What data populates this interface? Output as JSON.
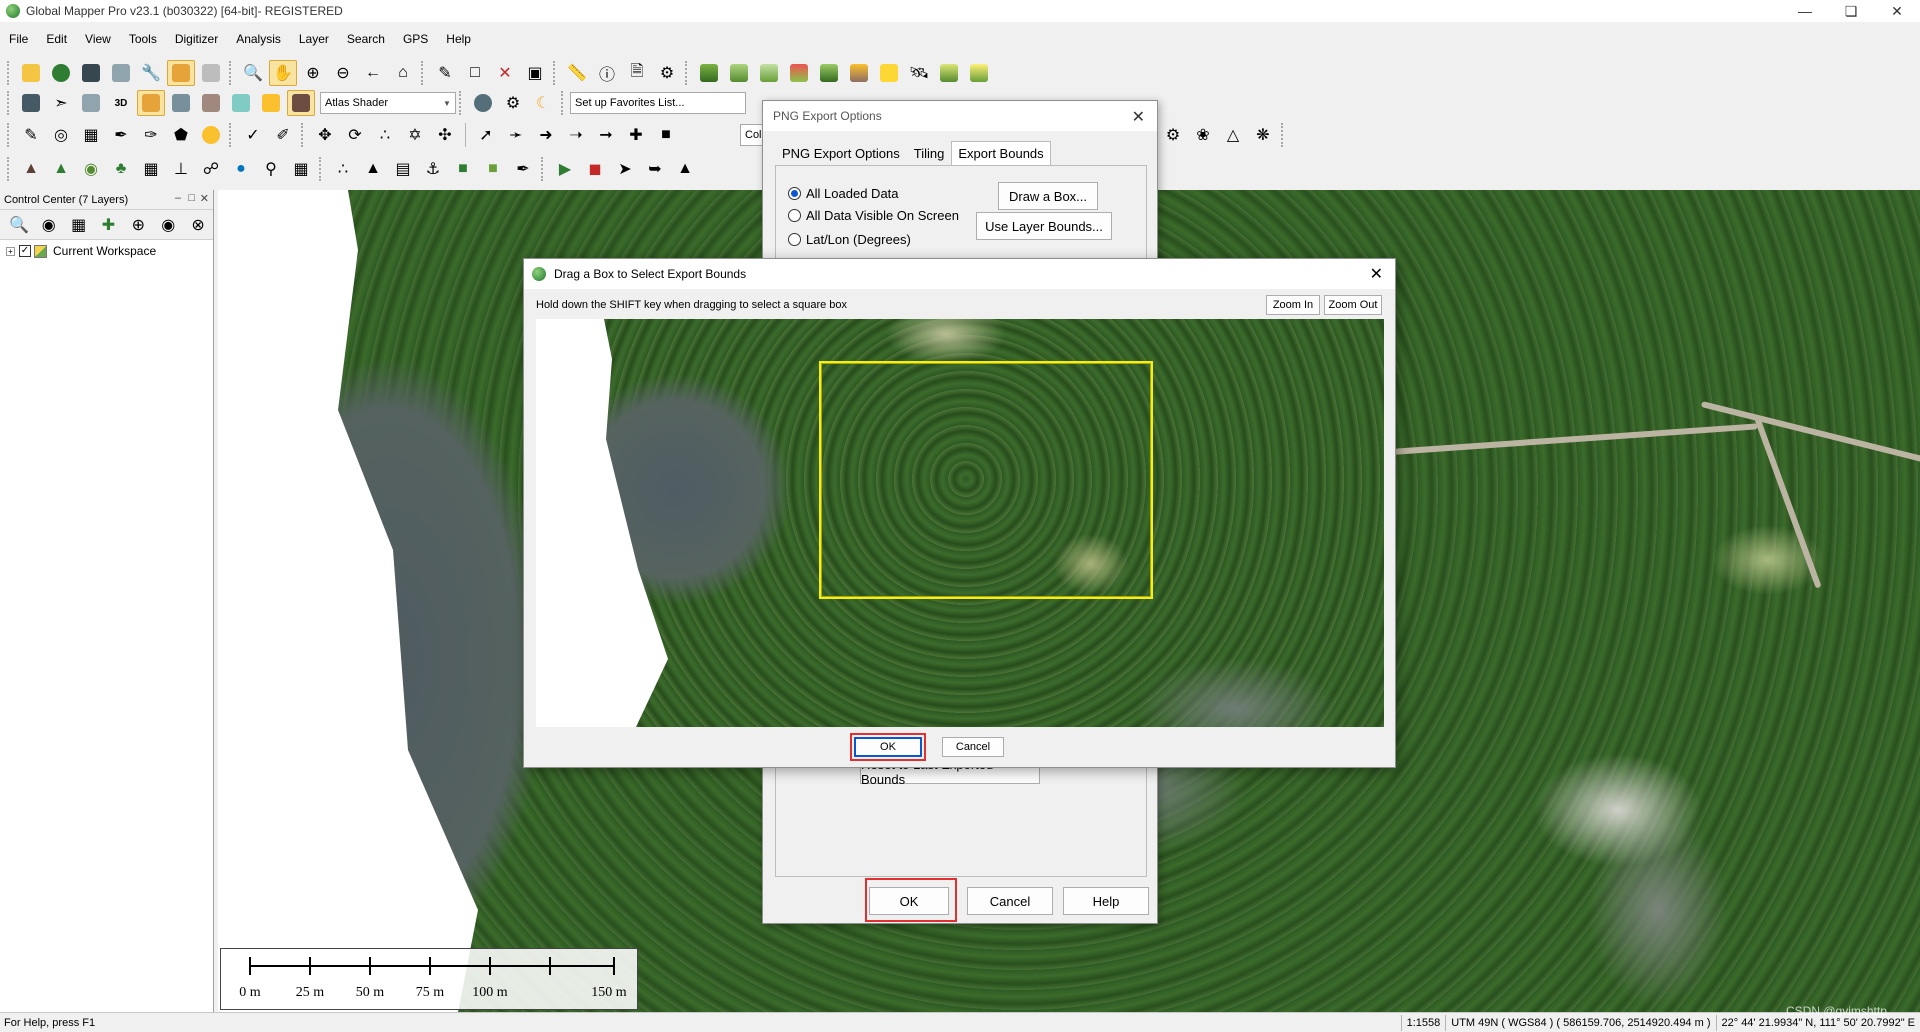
{
  "window": {
    "title": "Global Mapper Pro v23.1 (b030322) [64-bit]- REGISTERED"
  },
  "menu": [
    "File",
    "Edit",
    "View",
    "Tools",
    "Digitizer",
    "Analysis",
    "Layer",
    "Search",
    "GPS",
    "Help"
  ],
  "toolbar": {
    "shader_combo": "Atlas Shader",
    "favorites_combo": "Set up Favorites List...",
    "color_combo_partial": "Colo"
  },
  "control_center": {
    "title": "Control Center (7 Layers)",
    "workspace_label": "Current Workspace"
  },
  "scale_bar": {
    "labels": [
      "0 m",
      "25 m",
      "50 m",
      "75 m",
      "100 m",
      "150 m"
    ]
  },
  "status": {
    "help": "For Help, press F1",
    "scale": "1:1558",
    "projection": "UTM 49N ( WGS84 ) ( 586159.706, 2514920.494 m )",
    "latlon": "22° 44' 21.9934\" N, 111° 50' 20.7992\" E",
    "watermark": "CSDN @gvimshttp"
  },
  "png_dialog": {
    "title": "PNG Export Options",
    "tabs": [
      "PNG Export Options",
      "Tiling",
      "Export Bounds"
    ],
    "selected_tab": "Export Bounds",
    "radios": [
      "All Loaded Data",
      "All Data Visible On Screen",
      "Lat/Lon (Degrees)"
    ],
    "selected_radio": "All Loaded Data",
    "draw_box": "Draw a Box...",
    "use_layer_bounds": "Use Layer Bounds...",
    "reset_bounds": "Reset to Last Exported Bounds",
    "ok": "OK",
    "cancel": "Cancel",
    "help": "Help"
  },
  "drag_dialog": {
    "title": "Drag a Box to Select Export Bounds",
    "hint": "Hold down the SHIFT key when dragging to select a square box",
    "zoom_in": "Zoom In",
    "zoom_out": "Zoom Out",
    "ok": "OK",
    "cancel": "Cancel"
  },
  "colors": {
    "highlight": "#e03030",
    "selection_box": "#f2ef1b",
    "radio_accent": "#0b57d0",
    "active_tool": "#f9e3a0"
  }
}
